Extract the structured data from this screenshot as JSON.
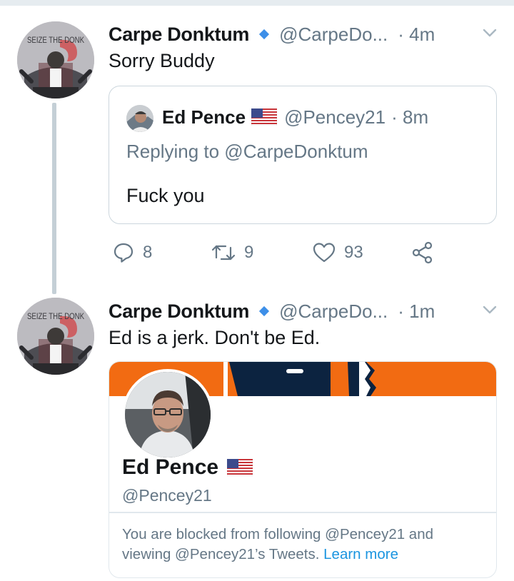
{
  "thread": [
    {
      "avatar_text": "SEIZE THE DONK",
      "author_name": "Carpe Donktum",
      "author_handle": "@CarpeDo...",
      "time": "· 4m",
      "text": "Sorry Buddy",
      "quoted_tweet": {
        "author_name": "Ed Pence",
        "author_handle": "@Pencey21",
        "time": "· 8m",
        "replying_to": "Replying to @CarpeDonktum",
        "text": "Fuck you"
      },
      "actions": {
        "reply_count": "8",
        "retweet_count": "9",
        "like_count": "93"
      }
    },
    {
      "avatar_text": "SEIZE THE DONK",
      "author_name": "Carpe Donktum",
      "author_handle": "@CarpeDo...",
      "time": "· 1m",
      "text": "Ed is a jerk. Don't be Ed.",
      "profile_card": {
        "name": "Ed Pence",
        "handle": "@Pencey21",
        "blocked_text": "You are blocked from following @Pencey21 and viewing @Pencey21’s Tweets.",
        "learn_more": "Learn more"
      }
    }
  ],
  "icons": {
    "verified": "verified-badge-icon",
    "menu": "chevron-down-icon",
    "reply": "reply-icon",
    "retweet": "retweet-icon",
    "like": "heart-icon",
    "share": "share-icon",
    "flag": "us-flag-icon"
  },
  "colors": {
    "text_primary": "#14171a",
    "text_secondary": "#657786",
    "link": "#1b95e0",
    "verified": "#3d8fe8",
    "banner_orange": "#f26b12",
    "banner_navy": "#0c2340",
    "border": "#ccd6dd"
  }
}
